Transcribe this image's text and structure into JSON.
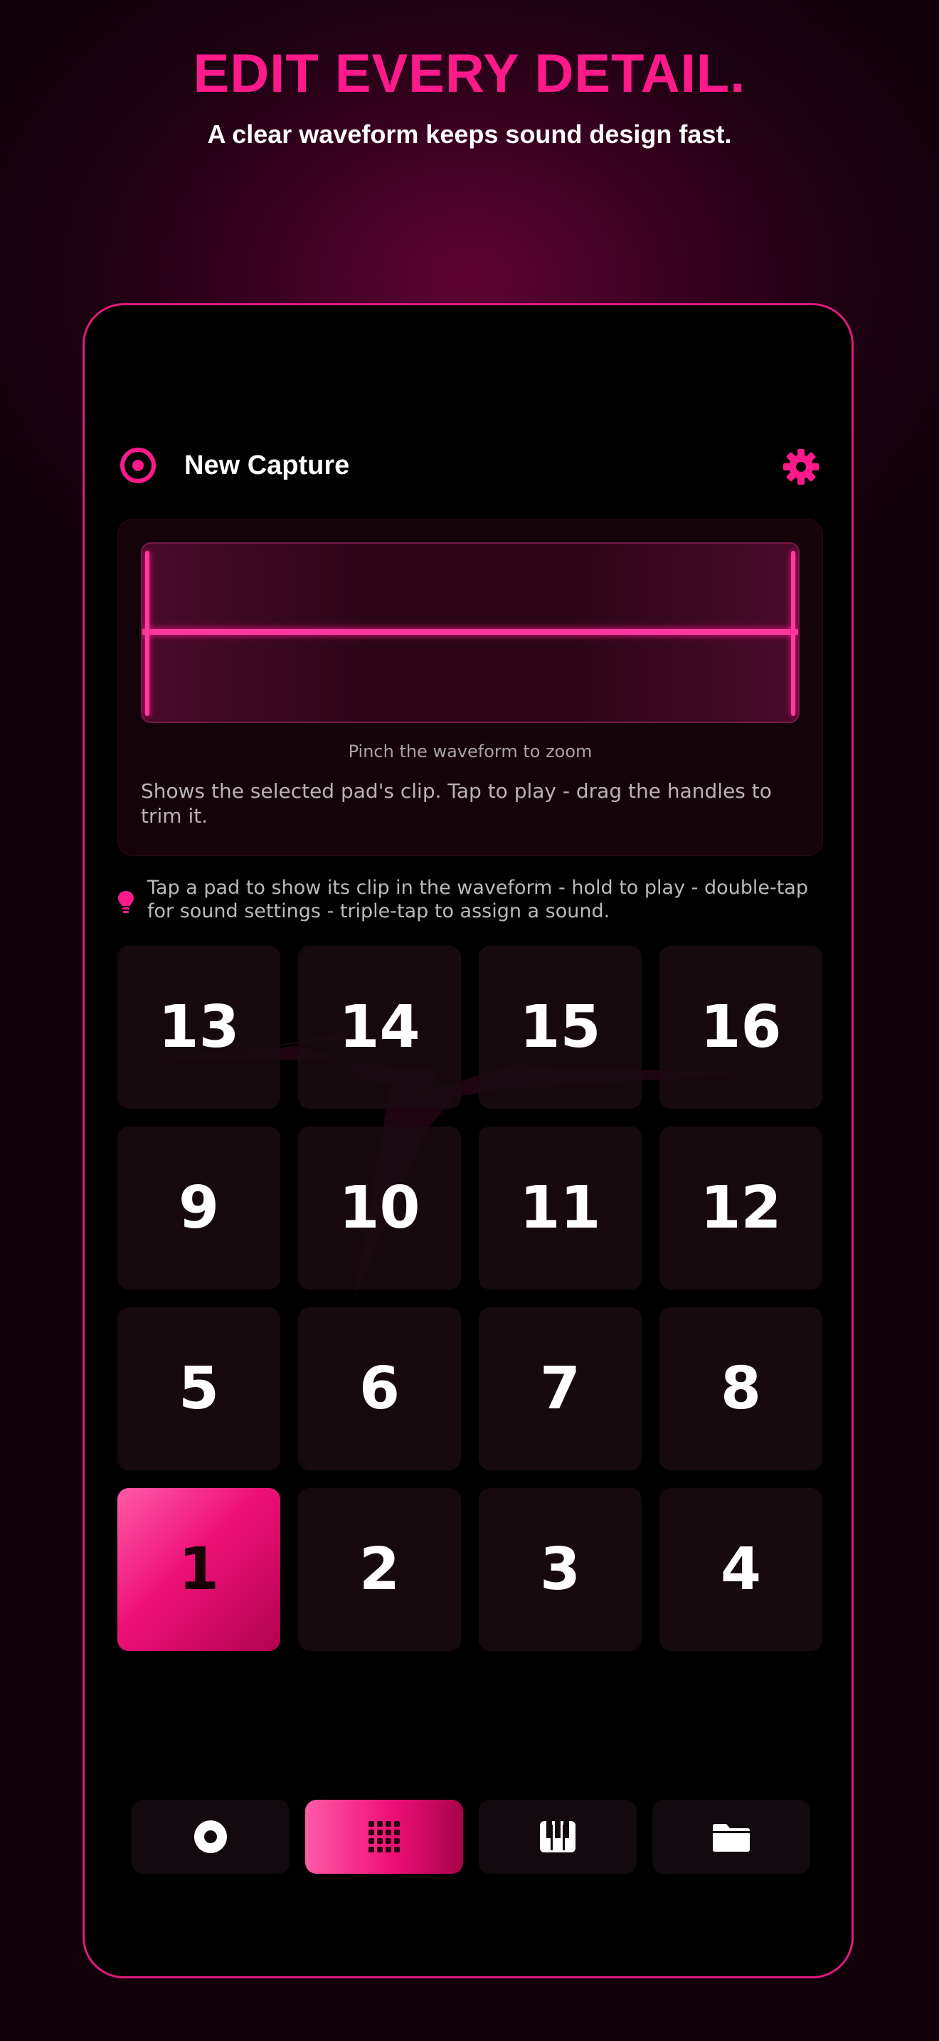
{
  "promo": {
    "headline": "EDIT EVERY DETAIL.",
    "subheadline": "A clear waveform keeps sound design fast."
  },
  "header": {
    "title": "New Capture",
    "record_icon": "record-icon",
    "settings_icon": "gear-icon"
  },
  "waveform": {
    "zoom_hint": "Pinch the waveform to zoom",
    "description": "Shows the selected pad's clip. Tap to play - drag the handles to trim it."
  },
  "tip": {
    "icon": "lightbulb-icon",
    "text": "Tap a pad to show its clip in the waveform - hold to play - double-tap for sound settings - triple-tap to assign a sound."
  },
  "pads": {
    "selected": "1",
    "rows": [
      [
        "13",
        "14",
        "15",
        "16"
      ],
      [
        "9",
        "10",
        "11",
        "12"
      ],
      [
        "5",
        "6",
        "7",
        "8"
      ],
      [
        "1",
        "2",
        "3",
        "4"
      ]
    ]
  },
  "tabs": [
    {
      "name": "record",
      "icon": "record-icon",
      "active": false
    },
    {
      "name": "pads",
      "icon": "grid-icon",
      "active": true
    },
    {
      "name": "keys",
      "icon": "piano-icon",
      "active": false
    },
    {
      "name": "files",
      "icon": "folder-icon",
      "active": false
    }
  ],
  "colors": {
    "accent": "#ff1a8c",
    "background": "#000000",
    "pad": "#1c0c12"
  }
}
